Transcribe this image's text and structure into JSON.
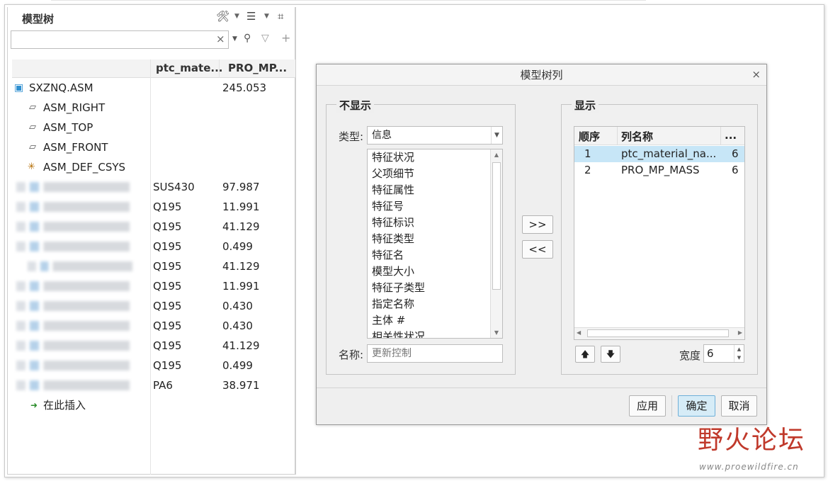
{
  "tree": {
    "title": "模型树",
    "columns": {
      "material": "ptc_mate...",
      "mass": "PRO_MP..."
    },
    "root": {
      "label": "SXZNQ.ASM",
      "mass": "245.053"
    },
    "datums": [
      "ASM_RIGHT",
      "ASM_TOP",
      "ASM_FRONT",
      "ASM_DEF_CSYS"
    ],
    "parts": [
      {
        "material": "SUS430",
        "mass": "97.987"
      },
      {
        "material": "Q195",
        "mass": "11.991"
      },
      {
        "material": "Q195",
        "mass": "41.129"
      },
      {
        "material": "Q195",
        "mass": "0.499"
      },
      {
        "material": "Q195",
        "mass": "41.129"
      },
      {
        "material": "Q195",
        "mass": "11.991"
      },
      {
        "material": "Q195",
        "mass": "0.430"
      },
      {
        "material": "Q195",
        "mass": "0.430"
      },
      {
        "material": "Q195",
        "mass": "41.129"
      },
      {
        "material": "Q195",
        "mass": "0.499"
      },
      {
        "material": "PA6",
        "mass": "38.971"
      }
    ],
    "insert_here": "在此插入"
  },
  "dialog": {
    "title": "模型树列",
    "left_group": "不显示",
    "type_label": "类型:",
    "type_value": "信息",
    "items": [
      "特征状况",
      "父项细节",
      "特征属性",
      "特征号",
      "特征标识",
      "特征类型",
      "特征名",
      "模型大小",
      "特征子类型",
      "指定名称",
      "主体 #",
      "相关性状况"
    ],
    "name_label": "名称:",
    "name_placeholder": "更新控制",
    "add_label": ">>",
    "remove_label": "<<",
    "right_group": "显示",
    "grid_headers": {
      "order": "顺序",
      "name": "列名称",
      "more": "..."
    },
    "grid_rows": [
      {
        "order": "1",
        "name": "ptc_material_na...",
        "width": "6"
      },
      {
        "order": "2",
        "name": "PRO_MP_MASS",
        "width": "6"
      }
    ],
    "width_label": "宽度",
    "width_value": "6",
    "apply_label": "应用",
    "ok_label": "确定",
    "cancel_label": "取消"
  },
  "watermark": {
    "main": "野火论坛",
    "sub": "www.proewildfire.cn"
  }
}
